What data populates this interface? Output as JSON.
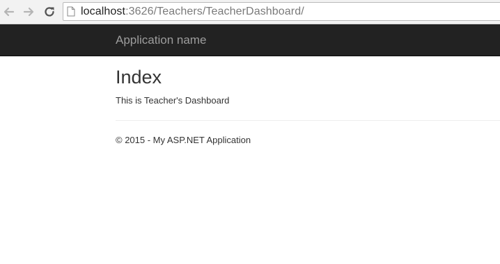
{
  "browser": {
    "url_host": "localhost",
    "url_path": ":3626/Teachers/TeacherDashboard/",
    "icons": [
      "back-arrow-icon",
      "forward-arrow-icon",
      "reload-icon",
      "page-icon"
    ]
  },
  "navbar": {
    "brand": "Application name",
    "background": "#222222",
    "brand_color": "#9d9d9d"
  },
  "main": {
    "title": "Index",
    "text": "This is Teacher's Dashboard"
  },
  "footer": {
    "text": "© 2015 - My ASP.NET Application"
  }
}
